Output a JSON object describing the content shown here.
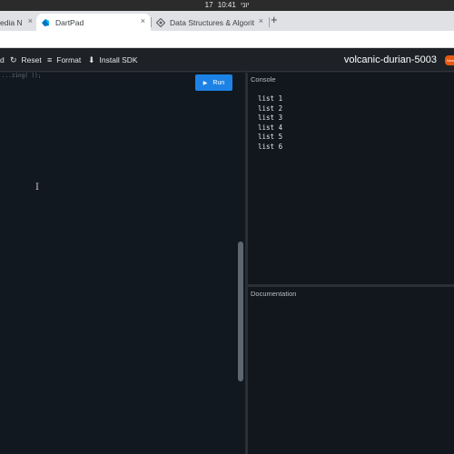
{
  "os": {
    "date": "17 יוני",
    "time": "10:41"
  },
  "browser": {
    "tabs": [
      {
        "label": "edia N",
        "active": false
      },
      {
        "label": "DartPad",
        "active": true
      },
      {
        "label": "Data Structures & Algorit",
        "active": false
      }
    ],
    "close_glyph": "×",
    "new_tab_glyph": "+"
  },
  "toolbar": {
    "items": [
      {
        "icon": "new-pad-icon",
        "label": "d"
      },
      {
        "icon": "reset-icon",
        "glyph": "↻",
        "label": "Reset"
      },
      {
        "icon": "format-icon",
        "glyph": "≡",
        "label": "Format"
      },
      {
        "icon": "download-icon",
        "glyph": "⬇",
        "label": "Install SDK"
      }
    ],
    "project_name": "volcanic-durian-5003",
    "badge": "New"
  },
  "editor": {
    "visible_code": "...zing( ));",
    "run_label": "Run",
    "run_glyph": "▶",
    "cursor_glyph": "I"
  },
  "console": {
    "title": "Console",
    "lines": [
      "list 1",
      "list 2",
      "list 3",
      "list 4",
      "list 5",
      "list 6"
    ]
  },
  "documentation": {
    "title": "Documentation"
  },
  "colors": {
    "accent": "#1d82e6",
    "background": "#1e2227",
    "editor_bg": "#111820",
    "panel_bg": "#12171d",
    "badge": "#e8570f"
  }
}
